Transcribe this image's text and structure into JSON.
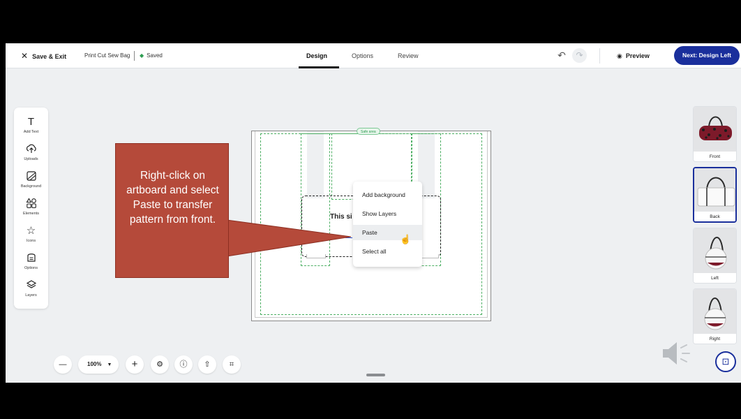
{
  "topbar": {
    "exit_label": "Save & Exit",
    "project_name": "Print Cut Sew Bag",
    "saved_status": "Saved",
    "tabs": [
      {
        "label": "Design",
        "active": true
      },
      {
        "label": "Options",
        "active": false
      },
      {
        "label": "Review",
        "active": false
      }
    ],
    "preview_label": "Preview",
    "next_label": "Next: Design Left"
  },
  "toolbar": {
    "items": [
      {
        "label": "Add Text",
        "icon": "text-icon"
      },
      {
        "label": "Uploads",
        "icon": "upload-icon"
      },
      {
        "label": "Background",
        "icon": "background-icon"
      },
      {
        "label": "Elements",
        "icon": "elements-icon"
      },
      {
        "label": "Icons",
        "icon": "star-icon"
      },
      {
        "label": "Options",
        "icon": "options-icon"
      },
      {
        "label": "Layers",
        "icon": "layers-icon"
      }
    ]
  },
  "canvas": {
    "safe_area_label": "Safe area",
    "side_text": "This si"
  },
  "context_menu": {
    "items": [
      {
        "label": "Add background",
        "highlighted": false
      },
      {
        "label": "Show Layers",
        "highlighted": false
      },
      {
        "label": "Paste",
        "highlighted": true
      },
      {
        "label": "Select all",
        "highlighted": false
      }
    ]
  },
  "callout": {
    "text": "Right-click on artboard and select Paste to transfer pattern from front.",
    "color": "#b54a3a"
  },
  "views": [
    {
      "label": "Front",
      "active": false
    },
    {
      "label": "Back",
      "active": true
    },
    {
      "label": "Left",
      "active": false
    },
    {
      "label": "Right",
      "active": false
    }
  ],
  "zoom": {
    "level": "100%"
  },
  "colors": {
    "accent": "#1a2f9c",
    "safe_area": "#4caf63",
    "canvas_bg": "#eef0f2"
  }
}
